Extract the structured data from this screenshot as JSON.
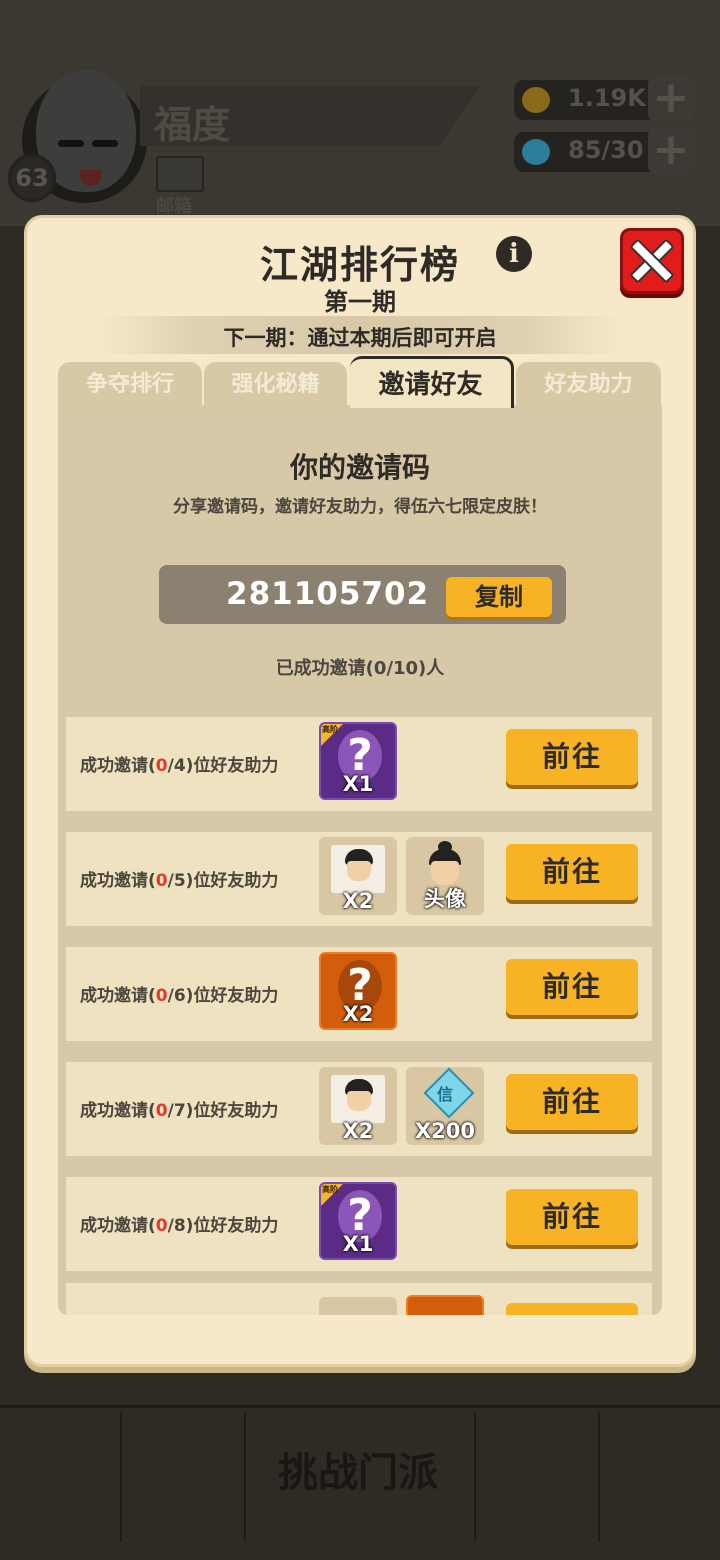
{
  "background": {
    "player_name": "福度",
    "player_level": "63",
    "mail_label": "邮箱",
    "gold": "1.19K",
    "energy": "85/30",
    "challenge_label": "挑战门派",
    "colors": {
      "gold_icon": "#8a6a1a",
      "energy_icon": "#2b7d9a"
    }
  },
  "panel": {
    "title": "江湖排行榜",
    "info_symbol": "i",
    "subtitle": "第一期",
    "notice": "下一期：通过本期后即可开启",
    "tabs": [
      {
        "label": "争夺排行",
        "active": false
      },
      {
        "label": "强化秘籍",
        "active": false
      },
      {
        "label": "邀请好友",
        "active": true
      },
      {
        "label": "好友助力",
        "active": false
      }
    ]
  },
  "invite": {
    "heading": "你的邀请码",
    "description": "分享邀请码，邀请好友助力，得伍六七限定皮肤！",
    "code": "281105702",
    "copy_label": "复制",
    "invited_summary": "已成功邀请(0/10)人"
  },
  "tasks": [
    {
      "prefix": "成功邀请(",
      "count": "0",
      "target": "/4)",
      "suffix": "位好友助力",
      "rewards": [
        {
          "type": "mystery-purple",
          "tier": "高阶",
          "qty": "X1"
        }
      ],
      "button": "前往"
    },
    {
      "prefix": "成功邀请(",
      "count": "0",
      "target": "/5)",
      "suffix": "位好友助力",
      "rewards": [
        {
          "type": "character-card",
          "qty": "X2"
        },
        {
          "type": "avatar",
          "qty": "头像"
        }
      ],
      "button": "前往"
    },
    {
      "prefix": "成功邀请(",
      "count": "0",
      "target": "/6)",
      "suffix": "位好友助力",
      "rewards": [
        {
          "type": "mystery-orange",
          "qty": "X2"
        }
      ],
      "button": "前往"
    },
    {
      "prefix": "成功邀请(",
      "count": "0",
      "target": "/7)",
      "suffix": "位好友助力",
      "rewards": [
        {
          "type": "character-card",
          "qty": "X2"
        },
        {
          "type": "gem",
          "glyph": "信",
          "qty": "X200"
        }
      ],
      "button": "前往"
    },
    {
      "prefix": "成功邀请(",
      "count": "0",
      "target": "/8)",
      "suffix": "位好友助力",
      "rewards": [
        {
          "type": "mystery-purple",
          "tier": "高阶",
          "qty": "X1"
        }
      ],
      "button": "前往"
    }
  ],
  "colors": {
    "panel_bg": "#f6e8c8",
    "button_yellow": "#f7b324",
    "close_red": "#e21b1b",
    "count_red": "#e23a2b"
  }
}
